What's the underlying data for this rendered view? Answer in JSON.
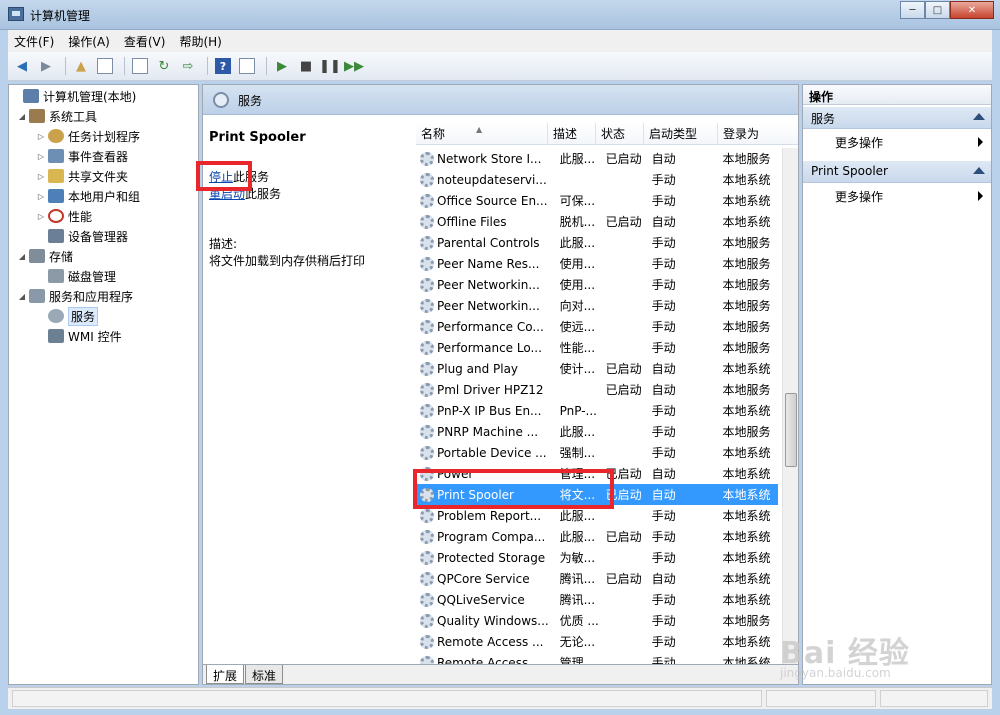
{
  "window": {
    "title": "计算机管理"
  },
  "menu": [
    "文件(F)",
    "操作(A)",
    "查看(V)",
    "帮助(H)"
  ],
  "tree": [
    {
      "label": "计算机管理(本地)",
      "icon": "computer-icon",
      "color": "#5b7fa8"
    },
    {
      "label": "系统工具",
      "icon": "tools-icon",
      "color": "#9a7b4f"
    },
    {
      "label": "任务计划程序",
      "icon": "clock-icon",
      "color": "#c9a24b"
    },
    {
      "label": "事件查看器",
      "icon": "event-viewer-icon",
      "color": "#6c8fb3"
    },
    {
      "label": "共享文件夹",
      "icon": "shared-folder-icon",
      "color": "#d9b650"
    },
    {
      "label": "本地用户和组",
      "icon": "users-icon",
      "color": "#4f7fb8"
    },
    {
      "label": "性能",
      "icon": "performance-icon",
      "color": "#c0392b"
    },
    {
      "label": "设备管理器",
      "icon": "device-manager-icon",
      "color": "#6b7f96"
    },
    {
      "label": "存储",
      "icon": "storage-icon",
      "color": "#7f8c99"
    },
    {
      "label": "磁盘管理",
      "icon": "disk-icon",
      "color": "#8c9aa8"
    },
    {
      "label": "服务和应用程序",
      "icon": "services-apps-icon",
      "color": "#8a99aa"
    },
    {
      "label": "服务",
      "icon": "services-gear-icon",
      "color": "#9aa8b8"
    },
    {
      "label": "WMI 控件",
      "icon": "wmi-icon",
      "color": "#6d7f93"
    }
  ],
  "mid_header": "服务",
  "extended": {
    "service_name": "Print Spooler",
    "stop_link": "停止",
    "stop_suffix": "此服务",
    "restart_link": "重启动",
    "restart_suffix": "此服务",
    "desc_label": "描述:",
    "desc_text": "将文件加载到内存供稍后打印"
  },
  "columns": [
    "名称",
    "描述",
    "状态",
    "启动类型",
    "登录为"
  ],
  "rows": [
    [
      "Network Store I...",
      "此服...",
      "已启动",
      "自动",
      "本地服务"
    ],
    [
      "noteupdateservi...",
      "",
      "",
      "手动",
      "本地系统"
    ],
    [
      "Office Source En...",
      "可保...",
      "",
      "手动",
      "本地系统"
    ],
    [
      "Offline Files",
      "脱机...",
      "已启动",
      "自动",
      "本地系统"
    ],
    [
      "Parental Controls",
      "此服...",
      "",
      "手动",
      "本地服务"
    ],
    [
      "Peer Name Res...",
      "使用...",
      "",
      "手动",
      "本地服务"
    ],
    [
      "Peer Networkin...",
      "使用...",
      "",
      "手动",
      "本地服务"
    ],
    [
      "Peer Networkin...",
      "向对...",
      "",
      "手动",
      "本地服务"
    ],
    [
      "Performance Co...",
      "使远...",
      "",
      "手动",
      "本地服务"
    ],
    [
      "Performance Lo...",
      "性能...",
      "",
      "手动",
      "本地服务"
    ],
    [
      "Plug and Play",
      "使计...",
      "已启动",
      "自动",
      "本地系统"
    ],
    [
      "Pml Driver HPZ12",
      "",
      "已启动",
      "自动",
      "本地服务"
    ],
    [
      "PnP-X IP Bus En...",
      "PnP-...",
      "",
      "手动",
      "本地系统"
    ],
    [
      "PNRP Machine ...",
      "此服...",
      "",
      "手动",
      "本地服务"
    ],
    [
      "Portable Device ...",
      "强制...",
      "",
      "手动",
      "本地系统"
    ],
    [
      "Power",
      "管理...",
      "已启动",
      "自动",
      "本地系统"
    ],
    [
      "Print Spooler",
      "将文...",
      "已启动",
      "自动",
      "本地系统"
    ],
    [
      "Problem Report...",
      "此服...",
      "",
      "手动",
      "本地系统"
    ],
    [
      "Program Compa...",
      "此服...",
      "已启动",
      "手动",
      "本地系统"
    ],
    [
      "Protected Storage",
      "为敏...",
      "",
      "手动",
      "本地系统"
    ],
    [
      "QPCore Service",
      "腾讯...",
      "已启动",
      "自动",
      "本地系统"
    ],
    [
      "QQLiveService",
      "腾讯...",
      "",
      "手动",
      "本地系统"
    ],
    [
      "Quality Windows...",
      "优质 ...",
      "",
      "手动",
      "本地服务"
    ],
    [
      "Remote Access ...",
      "无论...",
      "",
      "手动",
      "本地系统"
    ],
    [
      "Remote Access ...",
      "管理...",
      "",
      "手动",
      "本地系统"
    ]
  ],
  "selected_row": 16,
  "tabs": [
    "扩展",
    "标准"
  ],
  "actions": {
    "title": "操作",
    "sections": [
      {
        "label": "服务",
        "item": "更多操作"
      },
      {
        "label": "Print Spooler",
        "item": "更多操作"
      }
    ]
  },
  "watermark": {
    "main": "Bai 经验",
    "sub": "jingyan.baidu.com"
  },
  "colors": {
    "selection": "#3399ff",
    "highlight_box": "#e8262b",
    "link": "#0645ad"
  }
}
